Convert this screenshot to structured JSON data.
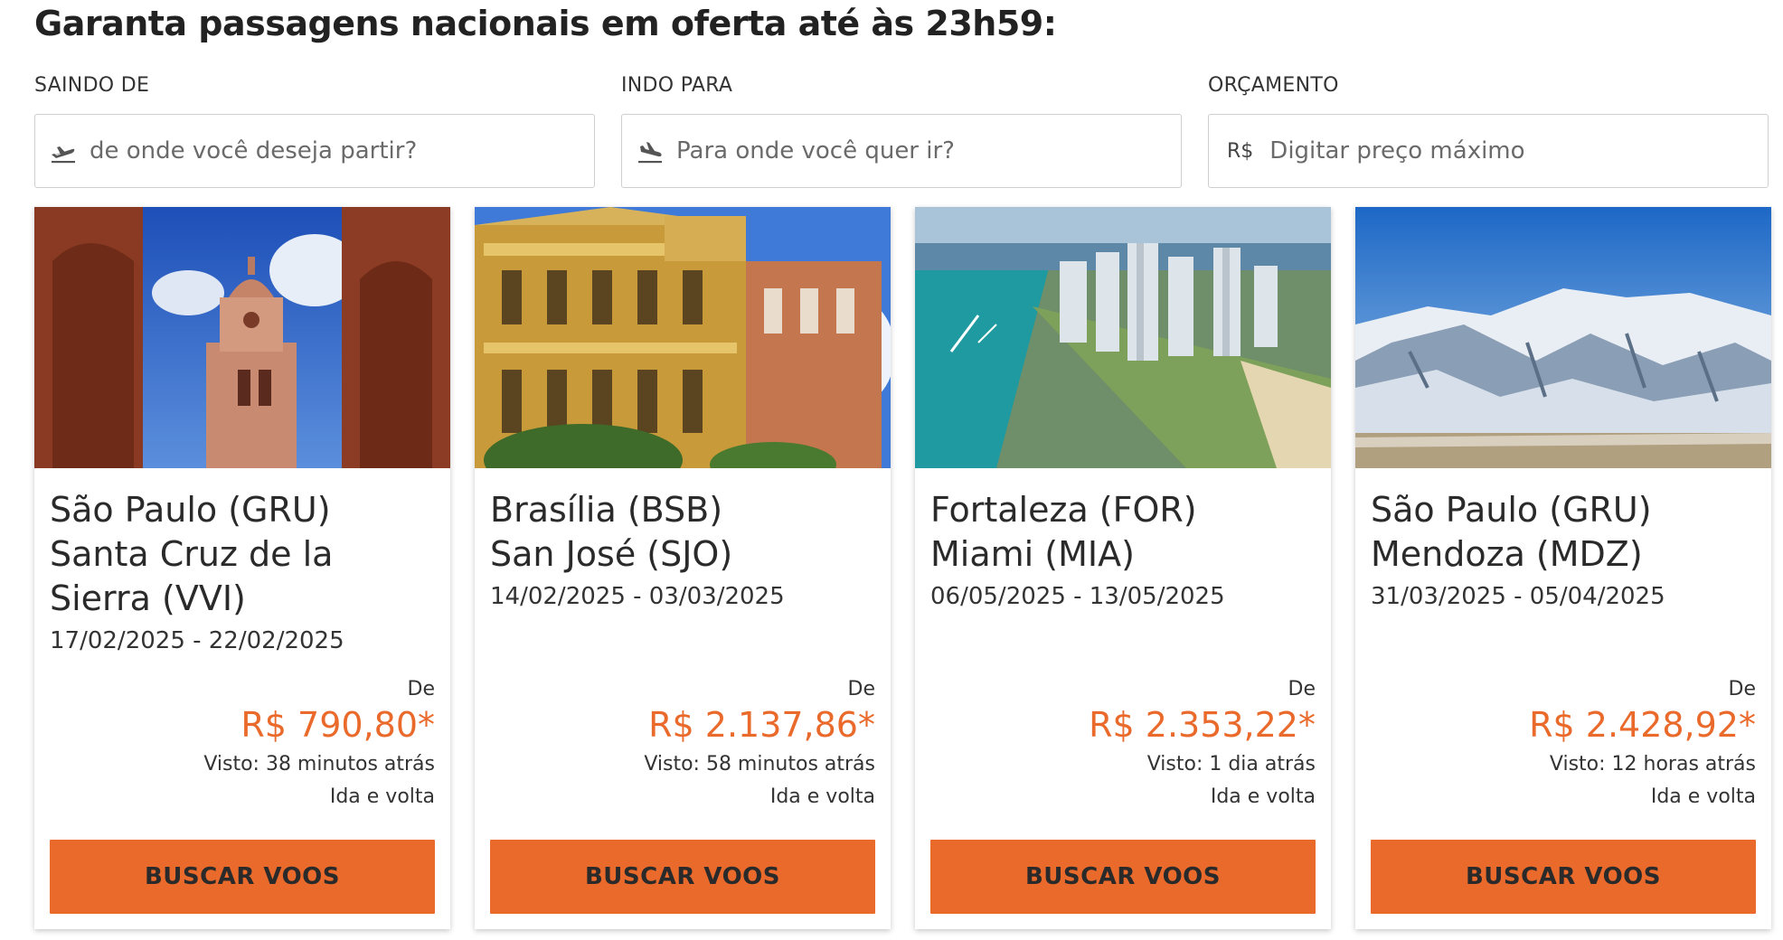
{
  "header": {
    "title": "Garanta passagens nacionais em oferta até às 23h59:"
  },
  "filters": {
    "origin": {
      "label": "SAINDO DE",
      "placeholder": "de onde você deseja partir?",
      "value": "",
      "icon": "plane-takeoff-icon"
    },
    "destination": {
      "label": "INDO PARA",
      "placeholder": "Para onde você quer ir?",
      "value": "",
      "icon": "plane-landing-icon"
    },
    "budget": {
      "label": "ORÇAMENTO",
      "currency": "R$",
      "placeholder": "Digitar preço máximo",
      "value": ""
    }
  },
  "colors": {
    "accent": "#ea6a2c",
    "text": "#2a2a2a",
    "border": "#cfcfcf"
  },
  "offers": [
    {
      "origin": "São Paulo (GRU)",
      "destination": "Santa Cruz de la Sierra (VVI)",
      "dates": "17/02/2025 - 22/02/2025",
      "from_label": "De",
      "price": "R$ 790,80*",
      "seen": "Visto: 38 minutos atrás",
      "trip_type": "Ida e volta",
      "button": "BUSCAR VOOS"
    },
    {
      "origin": "Brasília (BSB)",
      "destination": "San José (SJO)",
      "dates": "14/02/2025 - 03/03/2025",
      "from_label": "De",
      "price": "R$ 2.137,86*",
      "seen": "Visto: 58 minutos atrás",
      "trip_type": "Ida e volta",
      "button": "BUSCAR VOOS"
    },
    {
      "origin": "Fortaleza (FOR)",
      "destination": "Miami (MIA)",
      "dates": "06/05/2025 - 13/05/2025",
      "from_label": "De",
      "price": "R$ 2.353,22*",
      "seen": "Visto: 1 dia atrás",
      "trip_type": "Ida e volta",
      "button": "BUSCAR VOOS"
    },
    {
      "origin": "São Paulo (GRU)",
      "destination": "Mendoza (MDZ)",
      "dates": "31/03/2025 - 05/04/2025",
      "from_label": "De",
      "price": "R$ 2.428,92*",
      "seen": "Visto: 12 horas atrás",
      "trip_type": "Ida e volta",
      "button": "BUSCAR VOOS"
    }
  ]
}
